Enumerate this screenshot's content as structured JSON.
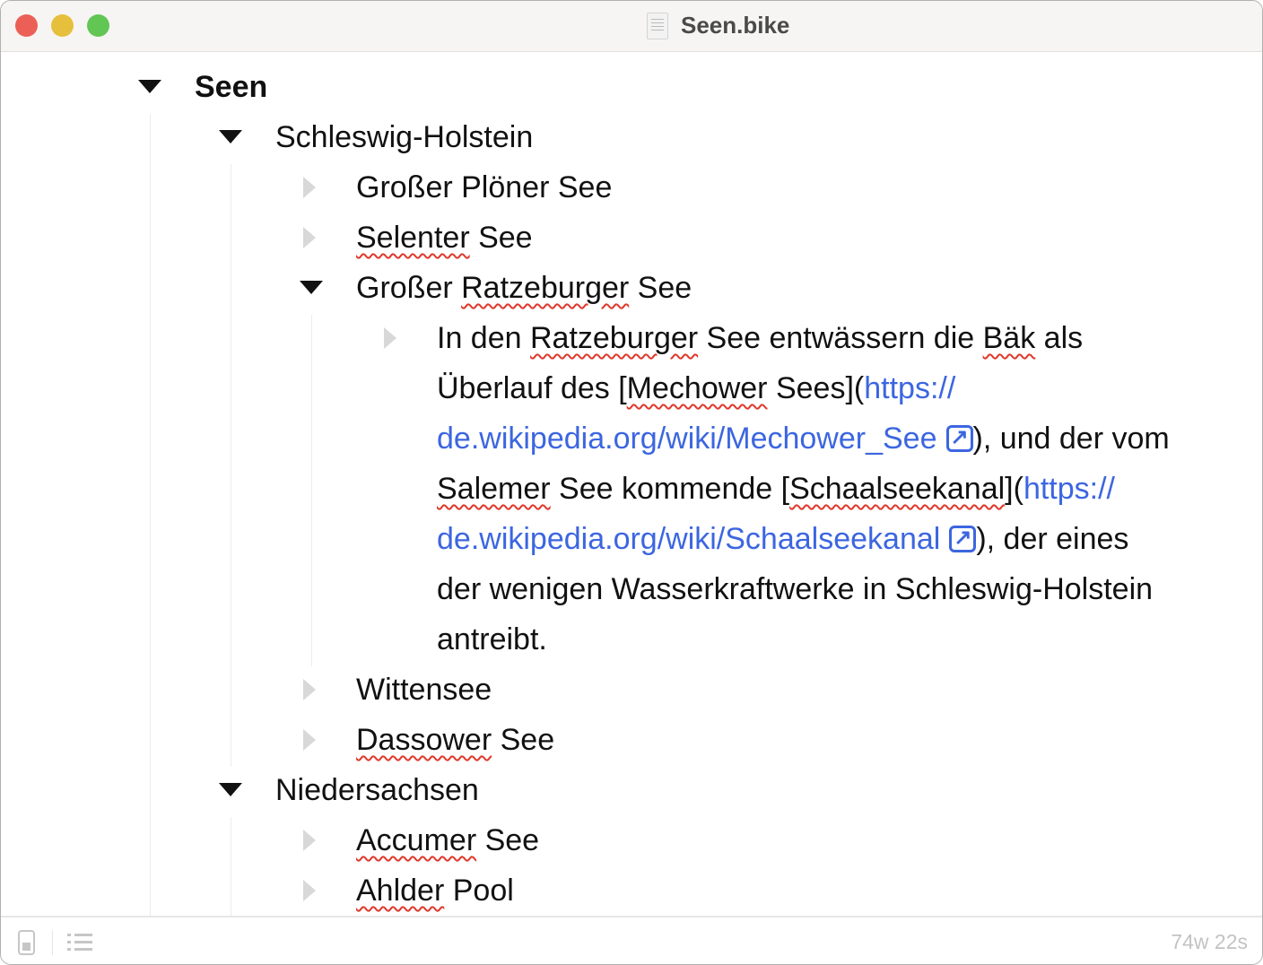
{
  "window": {
    "title": "Seen.bike",
    "file_icon": "document-icon",
    "traffic_lights": {
      "close": "#ec5f57",
      "minimize": "#e6bf3c",
      "zoom": "#62c654"
    }
  },
  "outline": [
    {
      "level": 0,
      "open": true,
      "bold": true,
      "segments": [
        {
          "t": "Seen"
        }
      ]
    },
    {
      "level": 1,
      "open": true,
      "segments": [
        {
          "t": "Schleswig-Holstein"
        }
      ]
    },
    {
      "level": 2,
      "open": false,
      "segments": [
        {
          "t": "Großer Plöner See"
        }
      ]
    },
    {
      "level": 2,
      "open": false,
      "segments": [
        {
          "t": "Selenter",
          "sp": true
        },
        {
          "t": " See"
        }
      ]
    },
    {
      "level": 2,
      "open": true,
      "segments": [
        {
          "t": "Großer "
        },
        {
          "t": "Ratzeburger",
          "sp": true
        },
        {
          "t": " See"
        }
      ]
    },
    {
      "level": 3,
      "open": false,
      "lines": [
        [
          {
            "t": "In den "
          },
          {
            "t": "Ratzeburger",
            "sp": true
          },
          {
            "t": " See entwässern die "
          },
          {
            "t": "Bäk",
            "sp": true
          },
          {
            "t": " als"
          }
        ],
        [
          {
            "t": "Überlauf des ["
          },
          {
            "t": "Mechower",
            "sp": true
          },
          {
            "t": " Sees]("
          },
          {
            "t": "https://",
            "link": true
          }
        ],
        [
          {
            "t": "de.wikipedia.org/wiki/Mechower_See",
            "link": true,
            "ext": true
          },
          {
            "t": "), und der vom"
          }
        ],
        [
          {
            "t": "Salemer",
            "sp": true
          },
          {
            "t": " See kommende ["
          },
          {
            "t": "Schaalseekanal",
            "sp": true
          },
          {
            "t": "]("
          },
          {
            "t": "https://",
            "link": true
          }
        ],
        [
          {
            "t": "de.wikipedia.org/wiki/Schaalseekanal",
            "link": true,
            "ext": true
          },
          {
            "t": "), der eines"
          }
        ],
        [
          {
            "t": "der wenigen Wasserkraftwerke in Schleswig-Holstein"
          }
        ],
        [
          {
            "t": "antreibt."
          }
        ]
      ]
    },
    {
      "level": 2,
      "open": false,
      "segments": [
        {
          "t": "Wittensee"
        }
      ]
    },
    {
      "level": 2,
      "open": false,
      "segments": [
        {
          "t": "Dassower",
          "sp": true
        },
        {
          "t": " See"
        }
      ]
    },
    {
      "level": 1,
      "open": true,
      "segments": [
        {
          "t": "Niedersachsen"
        }
      ]
    },
    {
      "level": 2,
      "open": false,
      "segments": [
        {
          "t": "Accumer",
          "sp": true
        },
        {
          "t": " See"
        }
      ]
    },
    {
      "level": 2,
      "open": false,
      "segments": [
        {
          "t": "Ahlder",
          "sp": true
        },
        {
          "t": " Pool"
        }
      ]
    }
  ],
  "status": {
    "count": "74w 22s"
  }
}
